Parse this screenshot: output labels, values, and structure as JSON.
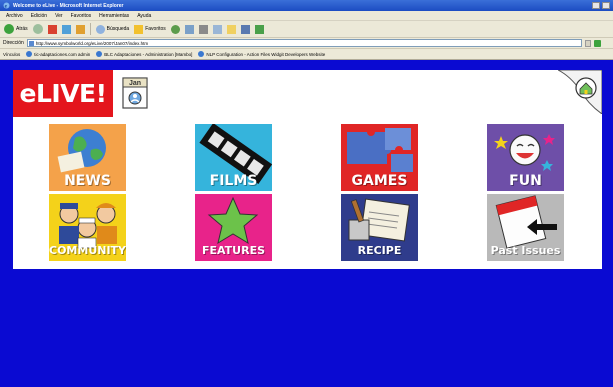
{
  "window": {
    "title": "Welcome to eLive - Microsoft Internet Explorer"
  },
  "menu": {
    "items": [
      "Archivo",
      "Edición",
      "Ver",
      "Favoritos",
      "Herramientas",
      "Ayuda"
    ]
  },
  "toolbar": {
    "back_label": "Atrás",
    "search_label": "Búsqueda",
    "favorites_label": "Favoritos"
  },
  "address": {
    "label": "Dirección",
    "url": "http://www.symbolworld.org/eLive/2007/Jan07/index.htm"
  },
  "links": {
    "label": "Vínculos",
    "items": [
      "tic-adaptaciones.com admin",
      "BLC Adaptaciones - Administration [Mambo]",
      "NLP Configuration - Action Files  Widgit Developers Website"
    ]
  },
  "site": {
    "logo_text": "eLIVE!",
    "issue_month": "Jan",
    "tiles": {
      "news": "NEWS",
      "films": "FILMS",
      "games": "GAMES",
      "fun": "FUN",
      "community": "COMMUNITY",
      "features": "FEATURES",
      "recipe": "RECIPE",
      "past_issues": "Past Issues"
    }
  },
  "colors": {
    "page_background": "#0a0ad2",
    "logo_red": "#e4151d",
    "news_orange": "#f4a24a",
    "films_cyan": "#35b4dc",
    "games_red": "#e02626",
    "fun_purple": "#6e4fa8",
    "community_yellow": "#f4d21a",
    "features_pink": "#e8238a",
    "recipe_navy": "#2f3c8c",
    "past_grey": "#b9b9b9"
  }
}
